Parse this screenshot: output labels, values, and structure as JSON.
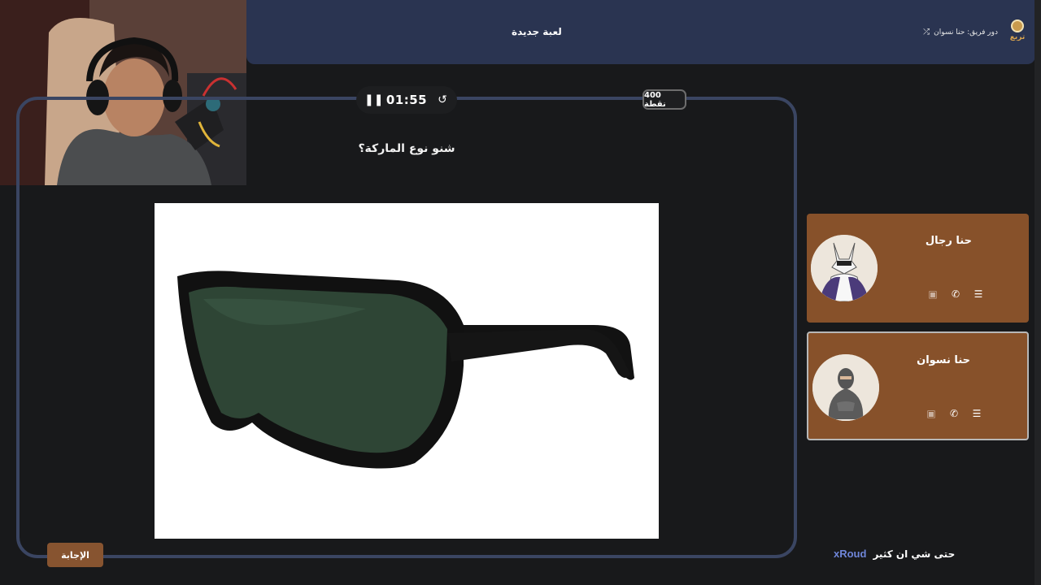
{
  "header": {
    "new_game": "لعبة جديدة",
    "turn_label": "دور فريق: حنا نسوان",
    "logo_text": "تريع"
  },
  "timer": {
    "time": "01:55"
  },
  "points": "400 نقطة",
  "question": "شنو نوع الماركة؟",
  "answer_button": "الإجابة",
  "teams": [
    {
      "name": "حنا رجال",
      "active": false
    },
    {
      "name": "حنا نسوان",
      "active": true
    }
  ],
  "chat": {
    "user": "xRoud",
    "message": "حتى شي ان كثير"
  },
  "colors": {
    "header_bg": "#2a3451",
    "panel_border": "#3a4562",
    "team_card": "#87512a",
    "answer_button": "#875430"
  },
  "icons": {
    "timer_pause": "pause-icon",
    "timer_reset": "reset-icon",
    "turn": "shuffle-icon",
    "team_actions": [
      "card-icon",
      "phone-icon",
      "list-icon"
    ]
  }
}
